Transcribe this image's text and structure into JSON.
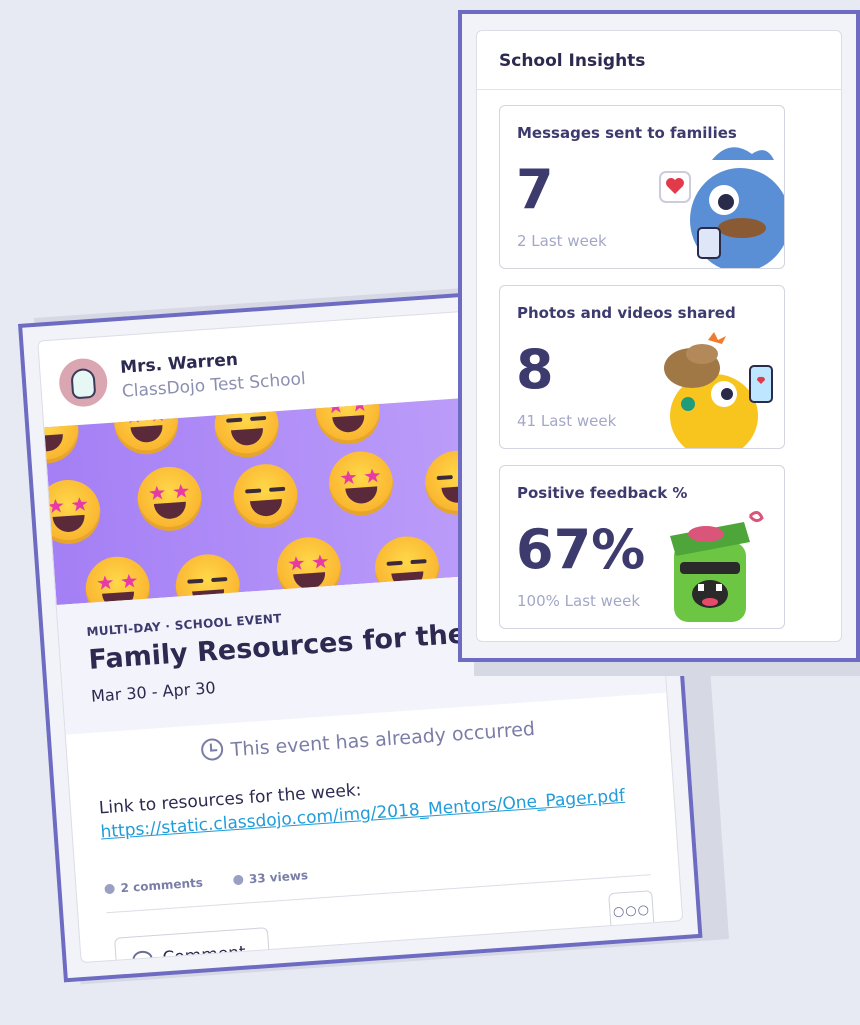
{
  "post": {
    "author": "Mrs. Warren",
    "school": "ClassDojo Test School",
    "event_type": "MULTI-DAY · SCHOOL EVENT",
    "event_title": "Family Resources for the week",
    "event_dates": "Mar 30 - Apr 30",
    "occurred_notice": "This event has already occurred",
    "body_text": "Link to resources for the week:",
    "body_link": "https://static.classdojo.com/img/2018_Mentors/One_Pager.pdf",
    "comments_count": "2 comments",
    "views_count": "33 views",
    "comment_button": "Comment",
    "more_button": "○○○"
  },
  "insights": {
    "title": "School Insights",
    "metrics": [
      {
        "label": "Messages sent to families",
        "value": "7",
        "sub": "2 Last week"
      },
      {
        "label": "Photos and videos shared",
        "value": "8",
        "sub": "41 Last week"
      },
      {
        "label": "Positive feedback %",
        "value": "67%",
        "sub": "100% Last week"
      }
    ]
  },
  "colors": {
    "frame": "#6d6bc2",
    "banner": "#a47ff5",
    "link": "#1f9cd9",
    "text_dark": "#2c2a50",
    "text_muted": "#a3a7c8"
  }
}
